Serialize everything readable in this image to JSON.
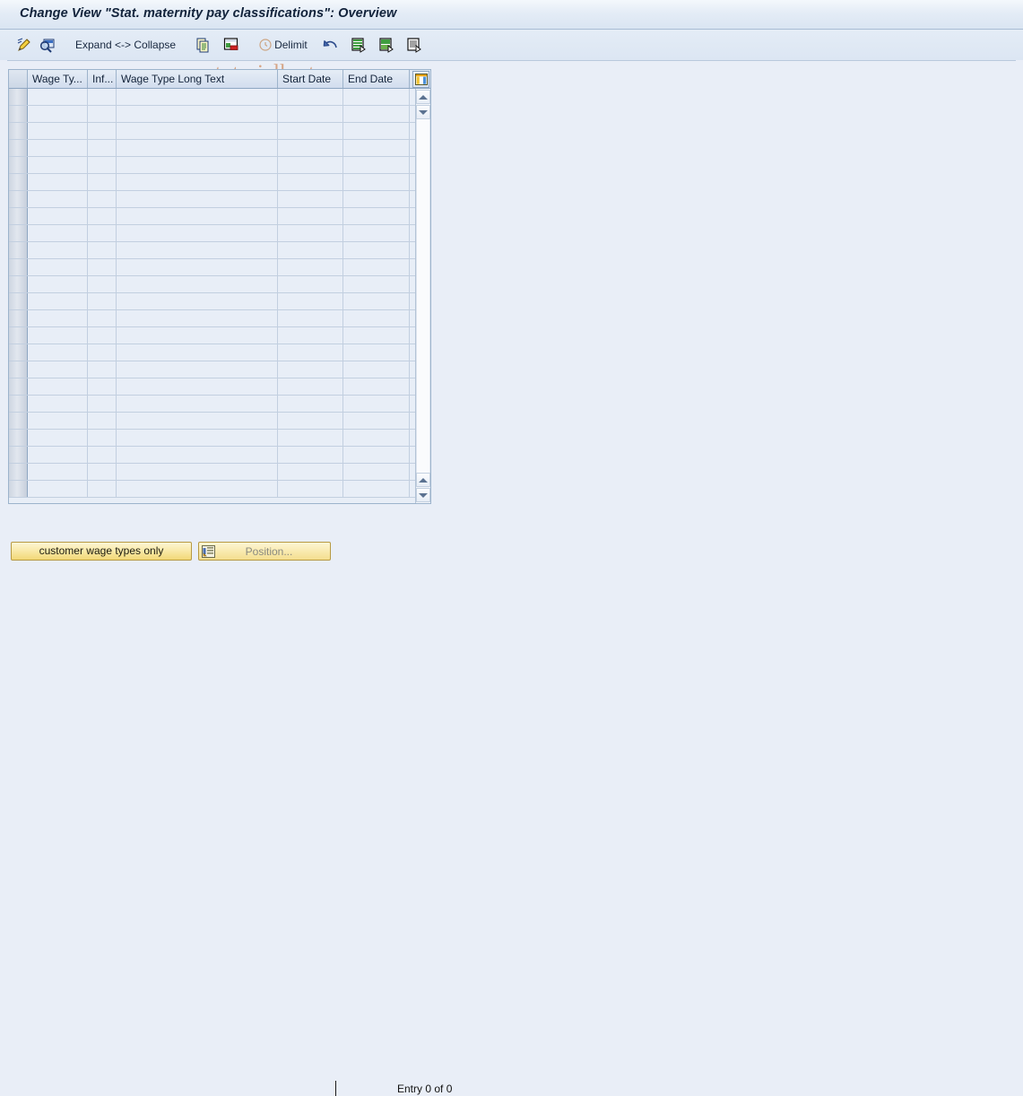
{
  "window": {
    "title": "Change View \"Stat. maternity pay classifications\": Overview"
  },
  "watermark": {
    "text": "www.tutorialkart.com",
    "color": "#c6621e"
  },
  "toolbar": {
    "items": [
      {
        "name": "change-display-pencil-icon",
        "icon": "pencil-paper-icon",
        "label": ""
      },
      {
        "name": "display-details-magnifier-icon",
        "icon": "magnifier-display-icon",
        "label": ""
      },
      {
        "name": "expand-collapse-button",
        "icon": "",
        "label": "Expand <-> Collapse"
      },
      {
        "name": "copy-as-button",
        "icon": "copy-documents-icon",
        "label": ""
      },
      {
        "name": "delete-row-button",
        "icon": "delete-row-icon",
        "label": ""
      },
      {
        "name": "delimit-button",
        "icon": "delimit-clock-icon",
        "label": "Delimit"
      },
      {
        "name": "undo-button",
        "icon": "undo-arrow-icon",
        "label": ""
      },
      {
        "name": "previous-entry-button",
        "icon": "list-prev-icon",
        "label": ""
      },
      {
        "name": "next-entry-button",
        "icon": "list-next-icon",
        "label": ""
      },
      {
        "name": "print-list-button",
        "icon": "list-print-icon",
        "label": ""
      }
    ]
  },
  "table": {
    "columns": [
      {
        "key": "wage_type",
        "label": "Wage Ty...",
        "width_class": "w-wagety"
      },
      {
        "key": "info",
        "label": "Inf...",
        "width_class": "w-inf"
      },
      {
        "key": "wage_long_text",
        "label": "Wage Type Long Text",
        "width_class": "w-long"
      },
      {
        "key": "start_date",
        "label": "Start Date",
        "width_class": "w-start"
      },
      {
        "key": "end_date",
        "label": "End Date",
        "width_class": "w-end"
      }
    ],
    "rows": [],
    "empty_row_count": 24,
    "column_config_icon": "column-settings-icon",
    "scroll": {
      "up_icon": "scroll-up-arrow-icon",
      "down_icon": "scroll-down-arrow-icon"
    }
  },
  "footer": {
    "customer_wage_types_button": "customer wage types only",
    "position_button": "Position...",
    "position_icon": "position-find-icon",
    "entry_status": "Entry 0 of 0"
  }
}
